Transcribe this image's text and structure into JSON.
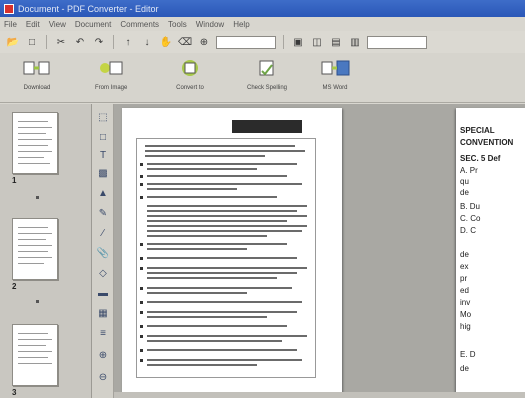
{
  "window": {
    "title": "Document - PDF Converter - Editor"
  },
  "menu": [
    "File",
    "Edit",
    "View",
    "Document",
    "Comments",
    "Tools",
    "Window",
    "Help"
  ],
  "toolbar": {
    "zoom_value": "",
    "search_placeholder": ""
  },
  "actions": [
    {
      "id": "download",
      "label": "Download",
      "color": "#9bc43f"
    },
    {
      "id": "from-image",
      "label": "From Image",
      "color": "#c4d445"
    },
    {
      "id": "convert",
      "label": "Convert to",
      "color": "#a7c94a"
    },
    {
      "id": "check-spelling",
      "label": "Check Spelling",
      "color": "#6fa447"
    },
    {
      "id": "ms-word",
      "label": "MS Word",
      "color": "#4a78c0"
    }
  ],
  "thumbnails": [
    {
      "label": "1"
    },
    {
      "label": "2"
    },
    {
      "label": "3"
    }
  ],
  "page2_lines": [
    {
      "text": "SPECIAL",
      "bold": true
    },
    {
      "text": "CONVENTION",
      "bold": true
    },
    {
      "text": "SEC. 5  Def",
      "bold": true
    },
    {
      "text": "A.      Pr",
      "bold": false
    },
    {
      "text": "        qu",
      "bold": false
    },
    {
      "text": "        de",
      "bold": false
    },
    {
      "text": "B.      Du",
      "bold": false
    },
    {
      "text": "C.      Co",
      "bold": false
    },
    {
      "text": "D.       C",
      "bold": false
    },
    {
      "text": "        de",
      "bold": false
    },
    {
      "text": "        ex",
      "bold": false
    },
    {
      "text": "        pr",
      "bold": false
    },
    {
      "text": "        ed",
      "bold": false
    },
    {
      "text": "        inv",
      "bold": false
    },
    {
      "text": "        Mo",
      "bold": false
    },
    {
      "text": "        hig",
      "bold": false
    },
    {
      "text": "E.       D",
      "bold": false
    },
    {
      "text": "        de",
      "bold": false
    }
  ]
}
